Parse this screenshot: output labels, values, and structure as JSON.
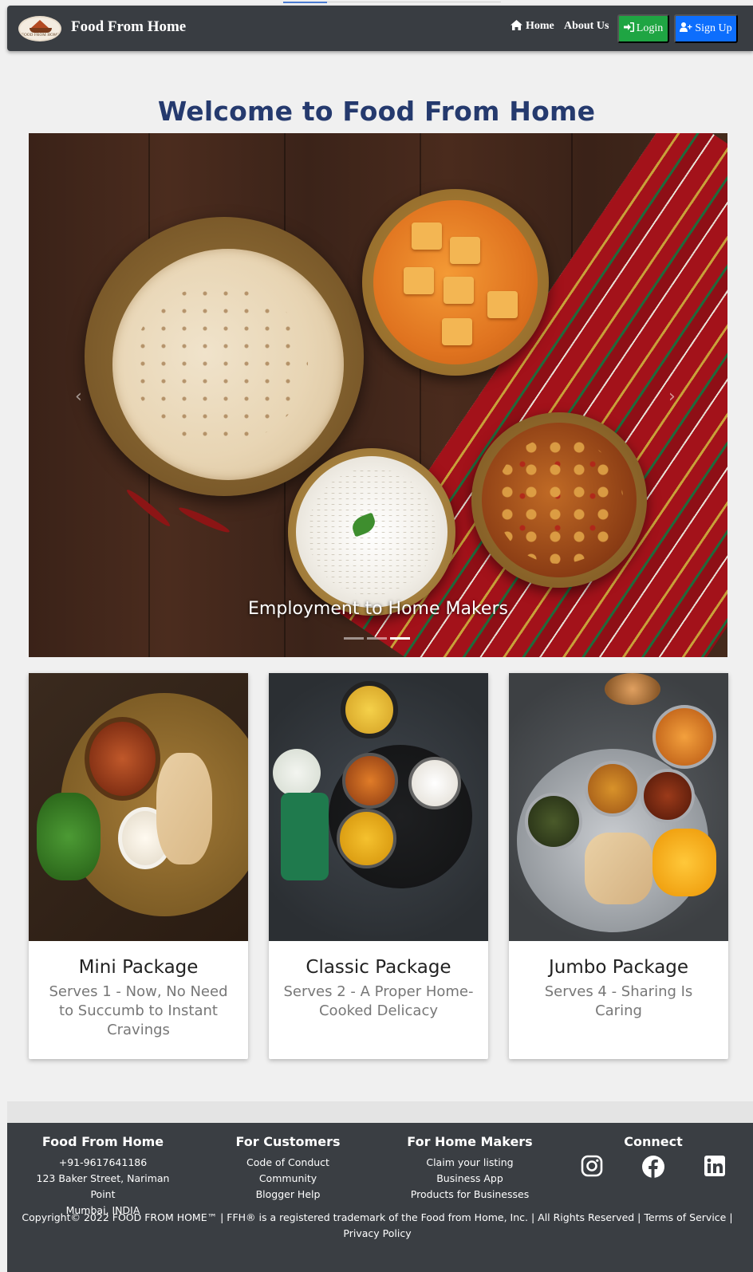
{
  "navbar": {
    "logo_text": "FOOD FROM HOME",
    "brand": "Food From Home",
    "links": {
      "home": "Home",
      "about": "About Us"
    },
    "login_label": "Login",
    "signup_label": "Sign Up"
  },
  "welcome": {
    "title": "Welcome to Food From Home"
  },
  "carousel": {
    "caption": "Employment to Home Makers",
    "slide_count": 3,
    "active_slide": 3,
    "prev_icon": "chevron-left-icon",
    "next_icon": "chevron-right-icon"
  },
  "packages": [
    {
      "title": "Mini Package",
      "subtitle": "Serves 1 - Now, No Need to Succumb to Instant Cravings"
    },
    {
      "title": "Classic Package",
      "subtitle": "Serves 2 - A Proper Home-Cooked Delicacy"
    },
    {
      "title": "Jumbo Package",
      "subtitle": "Serves 4 - Sharing Is Caring"
    }
  ],
  "footer": {
    "col1": {
      "title": "Food From Home",
      "lines": [
        "+91-9617641186",
        "123 Baker Street, Nariman Point",
        "Mumbai, INDIA"
      ]
    },
    "col2": {
      "title": "For Customers",
      "lines": [
        "Code of Conduct",
        "Community",
        "Blogger Help"
      ]
    },
    "col3": {
      "title": "For Home Makers",
      "lines": [
        "Claim your listing",
        "Business App",
        "Products for Businesses"
      ]
    },
    "col4": {
      "title": "Connect",
      "icons": [
        "instagram-icon",
        "facebook-icon",
        "linkedin-icon"
      ]
    },
    "copyright": "Copyright© 2022 FOOD FROM HOME™ | FFH® is a registered trademark of the Food from Home, Inc. | All Rights Reserved | Terms of Service | Privacy Policy"
  },
  "colors": {
    "navbar_bg": "#393d42",
    "login_btn": "#1fa543",
    "signup_btn": "#0d6efd",
    "title_color": "#253a6e",
    "footer_bg": "#3a3e43"
  }
}
